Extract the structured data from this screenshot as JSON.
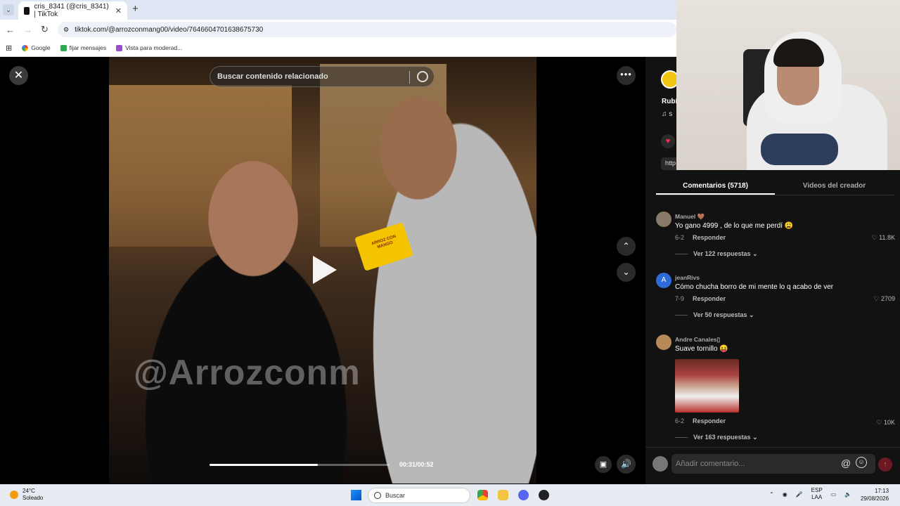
{
  "browser": {
    "tab_title": "cris_8341 (@cris_8341) | TikTok",
    "url": "tiktok.com/@arrozconmang00/video/7646604701638675730",
    "bookmarks": [
      "Google",
      "fijar mensajes",
      "Vista para moderad..."
    ]
  },
  "video": {
    "search_placeholder": "Buscar contenido relacionado",
    "watermark": "@Arrozconm",
    "mic_label": "ARROZ CON MANGO",
    "time": "00:31/00:52",
    "progress": 0.6
  },
  "creator": {
    "name_partial": "Rubí",
    "music_partial": "♫ s",
    "link_partial": "http"
  },
  "tabs": {
    "comments": "Comentarios (5718)",
    "creator_videos": "Videos del creador"
  },
  "comments": [
    {
      "user": "Manuel 🤎",
      "text": "Yo gano 4999 , de lo que me perdí 😩",
      "date": "6-2",
      "reply": "Responder",
      "likes": "11.8K",
      "more": "Ver 122 respuestas ⌄"
    },
    {
      "user": "jeanRivs",
      "text": "Cómo chucha borro de mi mente lo q acabo de ver",
      "date": "7-9",
      "reply": "Responder",
      "likes": "2709",
      "more": "Ver 50 respuestas ⌄",
      "avatar_letter": "A"
    },
    {
      "user": "Andre Canales▯",
      "text": "Suave tornillo 😝",
      "date": "6-2",
      "reply": "Responder",
      "likes": "10K",
      "more": "Ver 163 respuestas ⌄"
    }
  ],
  "input": {
    "placeholder": "Añadir comentario..."
  },
  "taskbar": {
    "temp": "24°C",
    "weather": "Soleado",
    "search": "Buscar",
    "lang1": "ESP",
    "lang2": "LAA",
    "time": "17:13",
    "date": "29/08/2026"
  },
  "colors": {
    "accent": "#fe2c55",
    "panel": "#121212"
  }
}
